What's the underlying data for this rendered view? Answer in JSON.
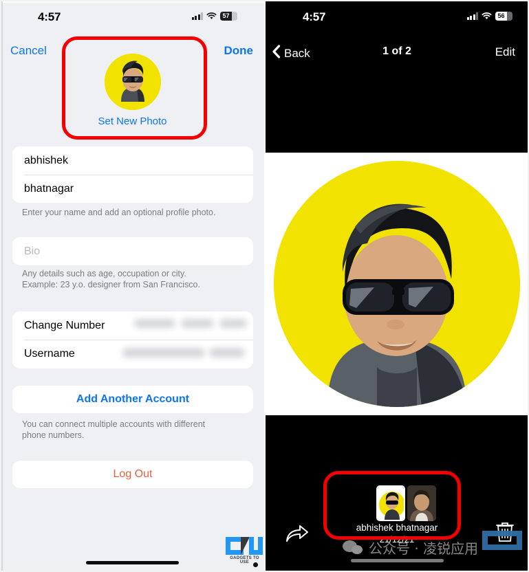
{
  "left_phone": {
    "status_bar": {
      "time": "4:57",
      "battery_percent": "57",
      "signal_icon": "cellular-signal-icon",
      "wifi_icon": "wifi-icon",
      "battery_icon": "battery-icon"
    },
    "nav": {
      "cancel_label": "Cancel",
      "done_label": "Done"
    },
    "avatar": {
      "set_new_photo_label": "Set New Photo",
      "background_color": "#f2e200"
    },
    "name_section": {
      "first_name": "abhishek",
      "last_name": "bhatnagar",
      "hint": "Enter your name and add an optional profile photo."
    },
    "bio_section": {
      "placeholder": "Bio",
      "hint_line1": "Any details such as age, occupation or city.",
      "hint_line2": "Example: 23 y.o. designer from San Francisco."
    },
    "account_section": {
      "change_number_label": "Change Number",
      "change_number_value": "",
      "username_label": "Username",
      "username_value": ""
    },
    "add_account": {
      "label": "Add Another Account",
      "hint_line1": "You can connect multiple accounts with different",
      "hint_line2": "phone numbers."
    },
    "logout": {
      "label": "Log Out",
      "color": "#e3603f"
    },
    "watermark": {
      "brand": "GADGETS TO USE"
    },
    "accent_color": "#0d74f2"
  },
  "right_phone": {
    "status_bar": {
      "time": "4:57",
      "battery_percent": "56",
      "signal_icon": "cellular-signal-icon",
      "wifi_icon": "wifi-icon",
      "battery_icon": "battery-icon"
    },
    "nav": {
      "back_label": "Back",
      "back_icon": "chevron-left-icon",
      "title": "1 of 2",
      "edit_label": "Edit"
    },
    "photo": {
      "background_color": "#ffffff",
      "circle_color": "#f2e200"
    },
    "thumbnails": [
      {
        "name": "thumbnail-1",
        "selected": true
      },
      {
        "name": "thumbnail-2",
        "selected": false
      }
    ],
    "meta": {
      "name": "abhishek bhatnagar",
      "date": "21/12/21"
    },
    "toolbar": {
      "share_icon": "share-arrow-icon",
      "delete_icon": "trash-icon"
    },
    "watermark": {
      "wechat_icon": "wechat-icon",
      "text": "公众号 · 凌锐应用"
    }
  },
  "annotations": {
    "highlight_color": "#f40000",
    "boxes": [
      {
        "name": "avatar-highlight-box"
      },
      {
        "name": "thumbnail-strip-highlight-box"
      }
    ]
  }
}
